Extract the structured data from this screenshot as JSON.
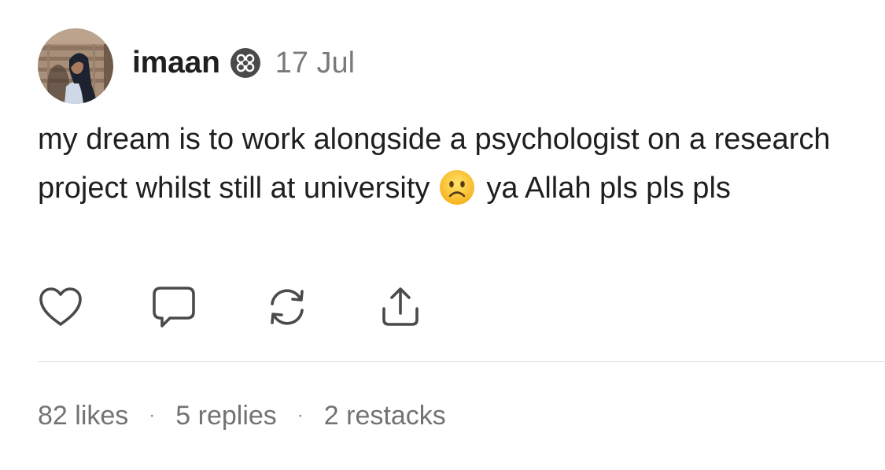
{
  "post": {
    "author": {
      "name": "imaan",
      "avatar_alt": "profile photo",
      "badge_icon": "flower-badge-icon"
    },
    "date": "17 Jul",
    "body": {
      "text_before_emoji": "my dream is to work alongside a psychologist on a research project whilst still at university",
      "emoji_icon": "frowning-face-icon",
      "text_after_emoji": "ya Allah pls pls pls"
    },
    "actions": [
      {
        "name": "like",
        "icon": "heart-icon"
      },
      {
        "name": "reply",
        "icon": "comment-icon"
      },
      {
        "name": "restack",
        "icon": "restack-icon"
      },
      {
        "name": "share",
        "icon": "share-icon"
      }
    ],
    "stats": {
      "likes": "82 likes",
      "replies": "5 replies",
      "restacks": "2 restacks",
      "separator": "·"
    }
  },
  "colors": {
    "text": "#1f1f1f",
    "muted": "#7a7a7a",
    "divider": "#dcdcdc",
    "icon": "#4a4a4a"
  }
}
